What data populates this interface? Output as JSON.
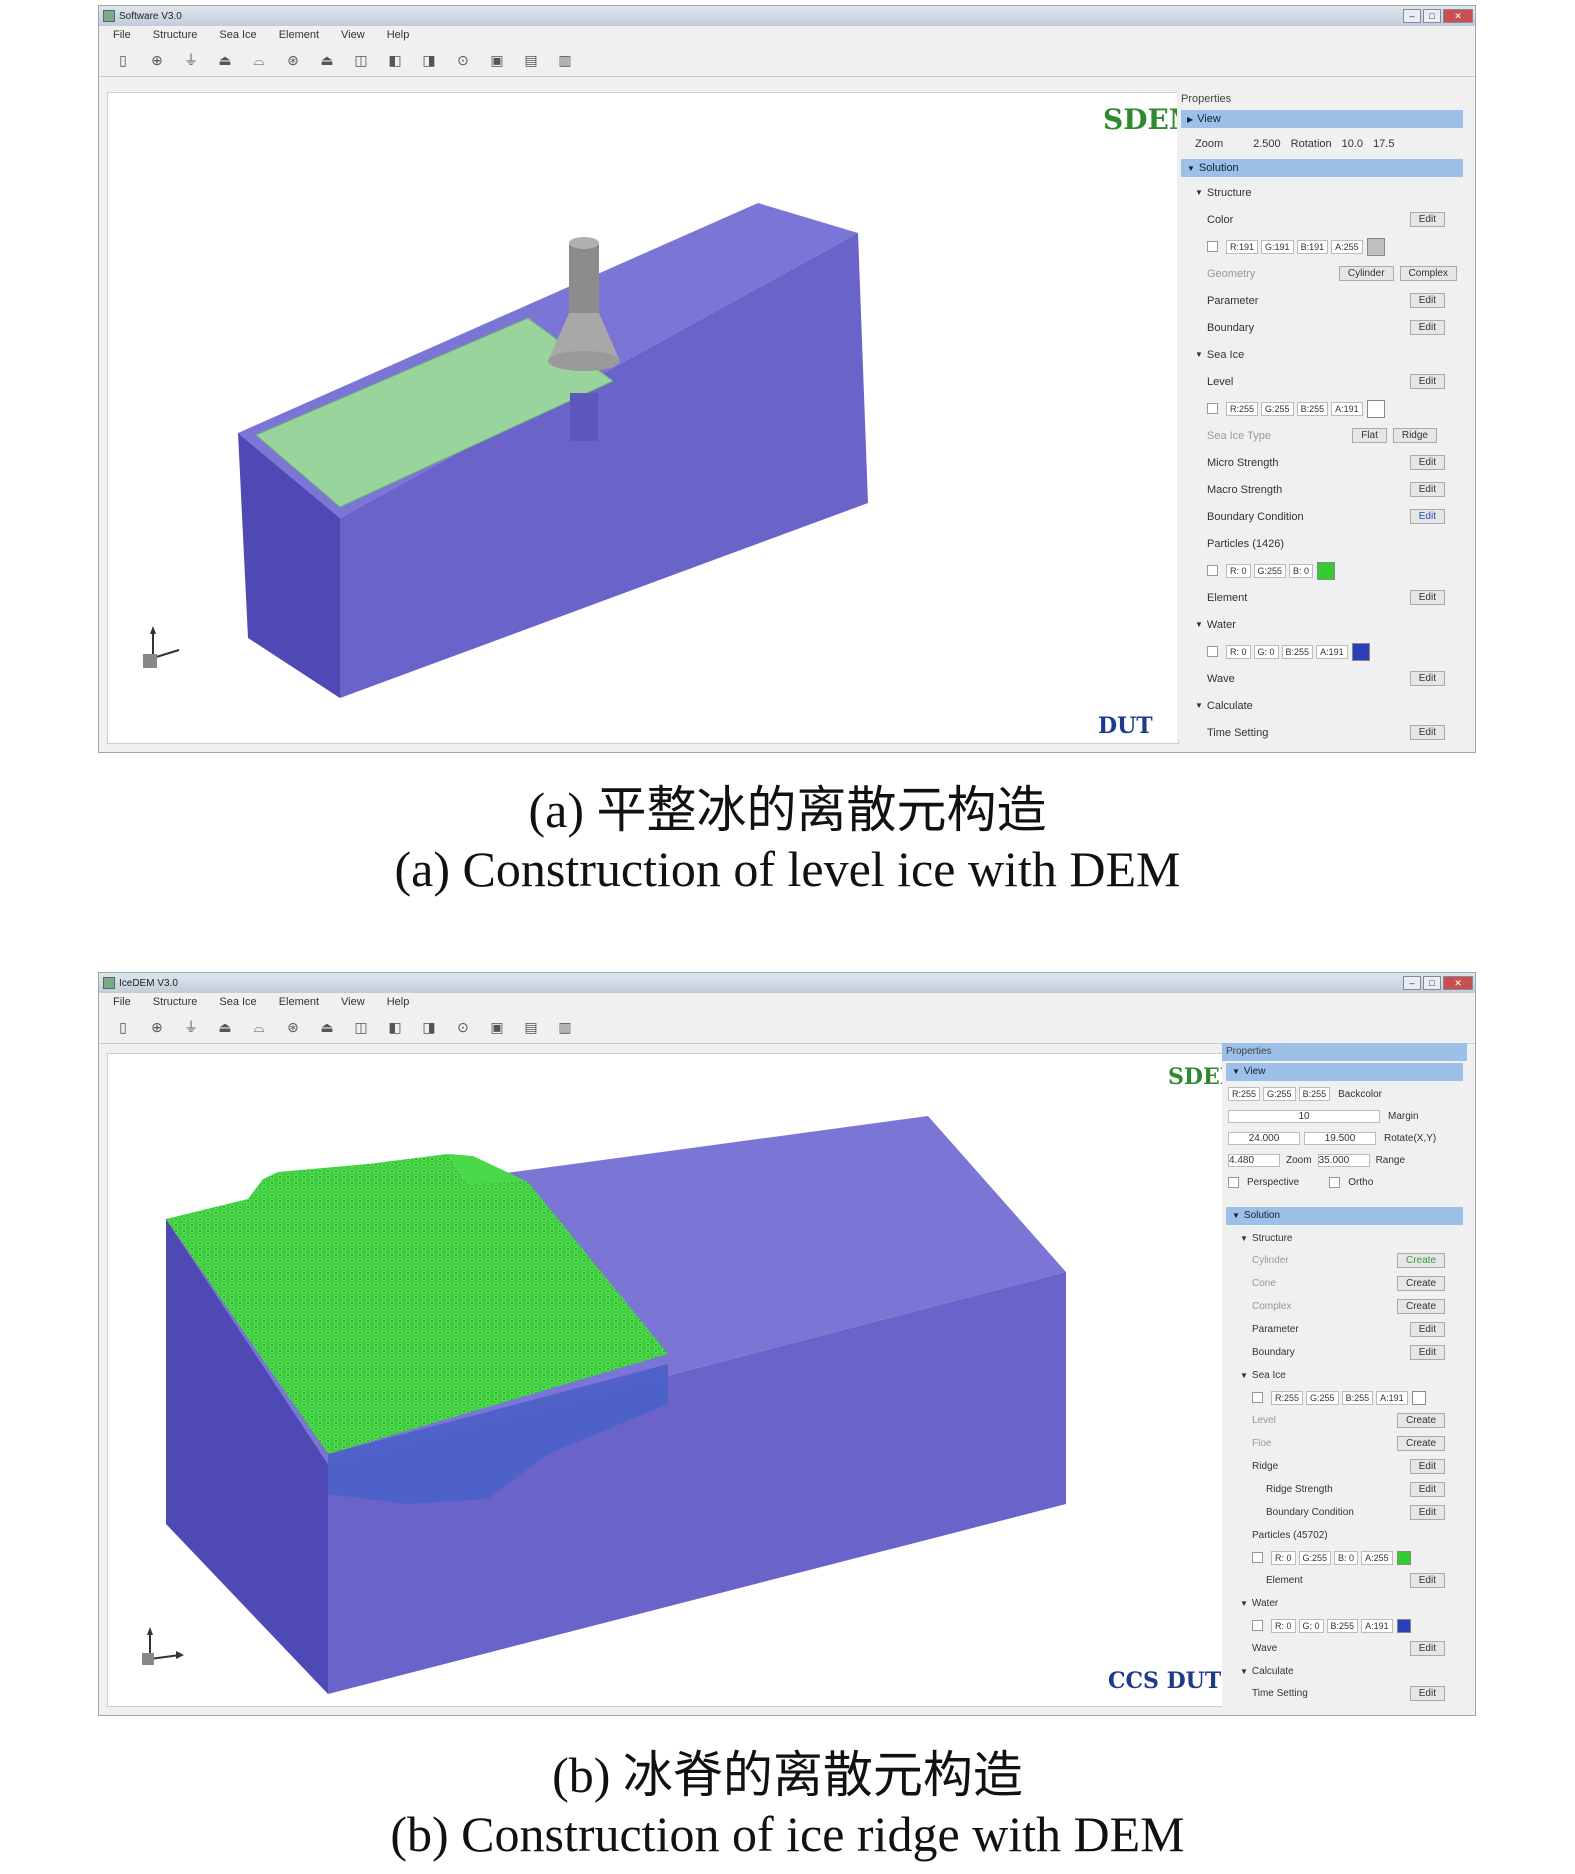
{
  "panel_a": {
    "window_title": "Software V3.0",
    "menu": [
      "File",
      "Structure",
      "Sea Ice",
      "Element",
      "View",
      "Help"
    ],
    "toolbar_icons": [
      "new-icon",
      "structure-icon",
      "cone-icon",
      "icebreaker-icon",
      "ship-icon",
      "jacket-icon",
      "platform-icon",
      "cube-icon",
      "box-icon",
      "grid-icon",
      "element-icon",
      "mesh-icon",
      "run-icon",
      "export-icon"
    ],
    "logo_s": "SDEM",
    "logo_dut": "DUT",
    "properties": {
      "header": "Properties",
      "view_section": "View",
      "zoom_label": "Zoom",
      "zoom_value": "2.500",
      "rotation_label": "Rotation",
      "rotation_x": "10.0",
      "rotation_y": "17.5",
      "solution_section": "Solution",
      "structure_group": "Structure",
      "color_label": "Color",
      "edit": "Edit",
      "structure_rgba": [
        "R:191",
        "G:191",
        "B:191",
        "A:255"
      ],
      "structure_swatch": "#bfbfbf",
      "geometry_label": "Geometry",
      "cylinder_btn": "Cylinder",
      "complex_btn": "Complex",
      "parameter_label": "Parameter",
      "boundary_label": "Boundary",
      "seaice_group": "Sea Ice",
      "level_label": "Level",
      "seaice_rgba": [
        "R:255",
        "G:255",
        "B:255",
        "A:191"
      ],
      "ice_type_label": "Sea Ice Type",
      "flat_btn": "Flat",
      "ridge_btn": "Ridge",
      "micro_label": "Micro Strength",
      "macro_label": "Macro Strength",
      "bc_label": "Boundary Condition",
      "particles_label": "Particles (1426)",
      "particle_rgb": [
        "R: 0",
        "G:255",
        "B: 0"
      ],
      "particle_swatch": "#33cc33",
      "element_label": "Element",
      "water_group": "Water",
      "water_rgba": [
        "R: 0",
        "G: 0",
        "B:255",
        "A:191"
      ],
      "water_swatch": "#2a3fb8",
      "wave_label": "Wave",
      "calculate_group": "Calculate",
      "time_label": "Time Setting"
    }
  },
  "panel_b": {
    "window_title": "IceDEM V3.0",
    "menu": [
      "File",
      "Structure",
      "Sea Ice",
      "Element",
      "View",
      "Help"
    ],
    "toolbar_icons": [
      "new-icon",
      "structure-icon",
      "cone-icon",
      "icebreaker-icon",
      "ship-icon",
      "jacket-icon",
      "platform-icon",
      "cube-icon",
      "box-icon",
      "grid-icon",
      "element-icon",
      "mesh-icon",
      "run-icon",
      "export-icon"
    ],
    "logo_s": "SDEM",
    "logo_dut": "CCS DUT",
    "properties": {
      "header": "Properties",
      "view_section": "View",
      "bg_rgb": [
        "R:255",
        "G:255",
        "B:255"
      ],
      "background_label": "Backcolor",
      "margin_value": "10",
      "margin_label": "Margin",
      "rot_x": "24.000",
      "rot_y": "19.500",
      "rotation_label": "Rotate(X,Y)",
      "range_value": "4.480",
      "zoom_label": "Zoom",
      "zoom_value": "35.000",
      "range_label": "Range",
      "perspective_label": "Perspective",
      "ortho_label": "Ortho",
      "solution_section": "Solution",
      "structure_group": "Structure",
      "cylinder_label": "Cylinder",
      "cone_label": "Cone",
      "complex_label": "Complex",
      "create": "Create",
      "edit": "Edit",
      "parameter_label": "Parameter",
      "boundary_label": "Boundary",
      "seaice_group": "Sea Ice",
      "seaice_rgba": [
        "R:255",
        "G:255",
        "B:255",
        "A:191"
      ],
      "level_label": "Level",
      "floe_label": "Floe",
      "ridge_label": "Ridge",
      "ridge_strength_label": "Ridge Strength",
      "bc_label": "Boundary Condition",
      "particles_label": "Particles (45702)",
      "particle_rgba": [
        "R: 0",
        "G:255",
        "B: 0",
        "A:255"
      ],
      "particle_swatch": "#33cc33",
      "element_label": "Element",
      "water_group": "Water",
      "water_rgba": [
        "R: 0",
        "G: 0",
        "B:255",
        "A:191"
      ],
      "water_swatch": "#2a3fb8",
      "wave_label": "Wave",
      "calculate_group": "Calculate",
      "time_label": "Time Setting"
    }
  },
  "captions": {
    "a_cn": "(a) 平整冰的离散元构造",
    "a_en": "(a) Construction of level ice with DEM",
    "b_cn": "(b) 冰脊的离散元构造",
    "b_en": "(b) Construction of ice ridge with DEM"
  },
  "colors": {
    "water_side": "#6a63c9",
    "water_top": "#7b75d6",
    "water_front": "#5b55c2",
    "ice_level": "#98d49c",
    "ice_ridge": "#3fcf3f",
    "structure": "#9a9a9a",
    "section_bar": "#9cc0e8"
  }
}
